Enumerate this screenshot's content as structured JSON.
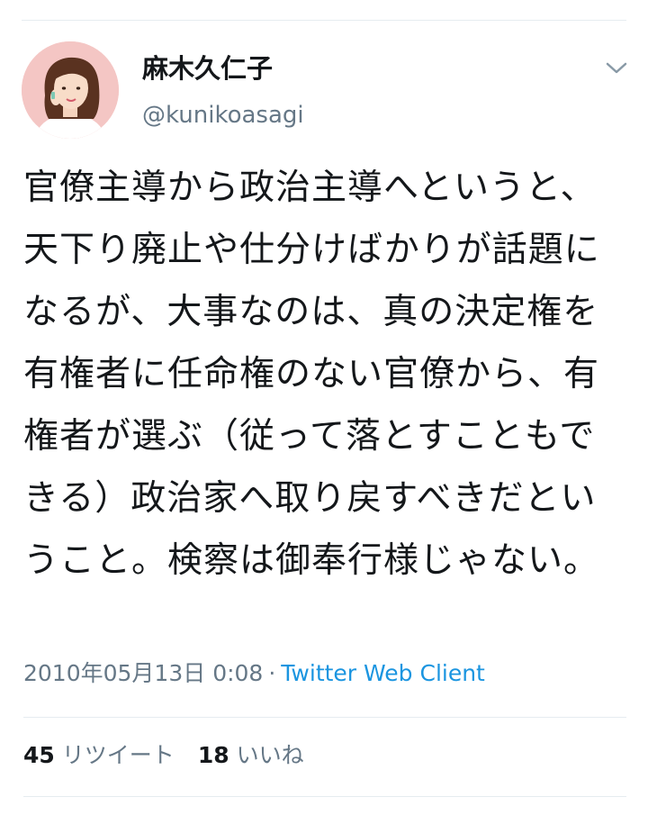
{
  "author": {
    "name": "麻木久仁子",
    "handle": "@kunikoasagi"
  },
  "tweet": {
    "text": "官僚主導から政治主導へというと、天下り廃止や仕分けばかりが話題になるが、大事なのは、真の決定権を有権者に任命権のない官僚から、有権者が選ぶ（従って落とすこともできる）政治家へ取り戻すべきだということ。検察は御奉行様じゃない。",
    "timestamp": "2010年05月13日 0:08",
    "separator": "·",
    "client": "Twitter Web Client"
  },
  "stats": {
    "retweets_count": "45",
    "retweets_label": "リツイート",
    "likes_count": "18",
    "likes_label": "いいね"
  },
  "colors": {
    "text": "#14171a",
    "secondary": "#657786",
    "link": "#1b95e0",
    "divider": "#e6ecf0"
  },
  "icons": {
    "menu": "chevron-down-icon"
  }
}
